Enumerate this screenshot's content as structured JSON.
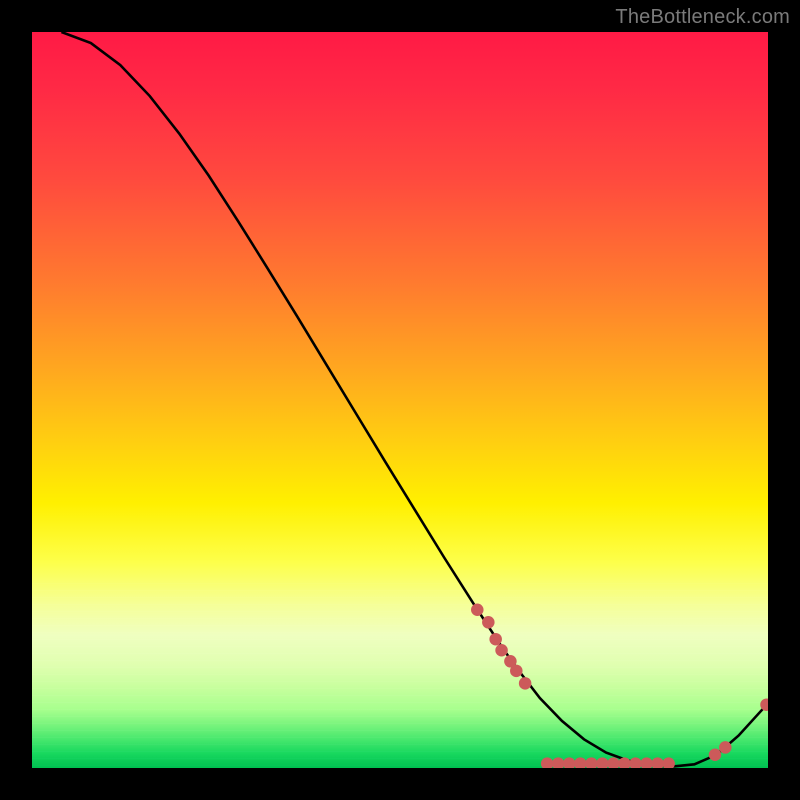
{
  "watermark": {
    "text": "TheBottleneck.com"
  },
  "chart_data": {
    "type": "line",
    "title": "",
    "xlabel": "",
    "ylabel": "",
    "xlim": [
      0,
      100
    ],
    "ylim": [
      0,
      100
    ],
    "grid": false,
    "legend": false,
    "line_color": "#000000",
    "marker_color": "#cc5a5a",
    "series": [
      {
        "name": "curve",
        "x": [
          4,
          8,
          12,
          16,
          20,
          24,
          28,
          32,
          36,
          40,
          44,
          48,
          52,
          56,
          60,
          64,
          66,
          69,
          72,
          75,
          78,
          81,
          84,
          87,
          90,
          93,
          96,
          100
        ],
        "y": [
          100,
          98.5,
          95.5,
          91.3,
          86.2,
          80.5,
          74.3,
          67.9,
          61.4,
          54.8,
          48.2,
          41.6,
          35.1,
          28.6,
          22.3,
          16.2,
          13.4,
          9.5,
          6.4,
          3.9,
          2.1,
          1.0,
          0.4,
          0.2,
          0.5,
          1.8,
          4.4,
          8.8
        ]
      }
    ],
    "markers": [
      {
        "x": 60.5,
        "y": 21.5
      },
      {
        "x": 62.0,
        "y": 19.8
      },
      {
        "x": 63.0,
        "y": 17.5
      },
      {
        "x": 63.8,
        "y": 16.0
      },
      {
        "x": 65.0,
        "y": 14.5
      },
      {
        "x": 65.8,
        "y": 13.2
      },
      {
        "x": 67.0,
        "y": 11.5
      },
      {
        "x": 70.0,
        "y": 0.6
      },
      {
        "x": 71.5,
        "y": 0.6
      },
      {
        "x": 73.0,
        "y": 0.6
      },
      {
        "x": 74.5,
        "y": 0.6
      },
      {
        "x": 76.0,
        "y": 0.6
      },
      {
        "x": 77.5,
        "y": 0.6
      },
      {
        "x": 79.0,
        "y": 0.6
      },
      {
        "x": 80.5,
        "y": 0.6
      },
      {
        "x": 82.0,
        "y": 0.6
      },
      {
        "x": 83.5,
        "y": 0.6
      },
      {
        "x": 85.0,
        "y": 0.6
      },
      {
        "x": 86.5,
        "y": 0.6
      },
      {
        "x": 92.8,
        "y": 1.8
      },
      {
        "x": 94.2,
        "y": 2.8
      },
      {
        "x": 99.8,
        "y": 8.6
      }
    ]
  }
}
